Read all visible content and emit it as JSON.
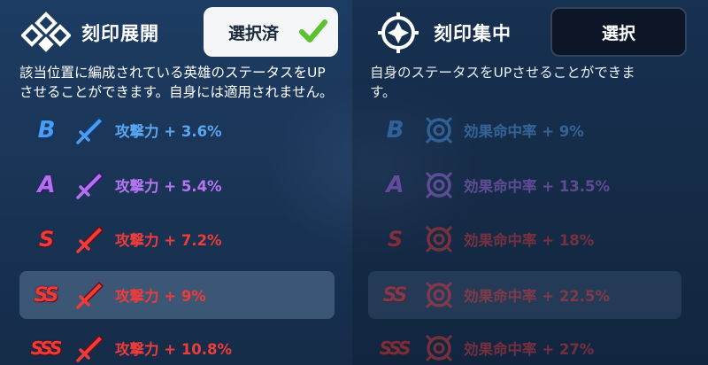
{
  "left_panel": {
    "title": "刻印展開",
    "button_label": "選択済",
    "button_state": "selected",
    "description_line1": "該当位置に編成されている英雄のステータスをUP",
    "description_line2": "させることができます。自身には適用されません。",
    "rows": [
      {
        "grade": "B",
        "stat_label": "攻撃力",
        "value": "+ 3.6%",
        "color": "#5aa6f2",
        "highlighted": false
      },
      {
        "grade": "A",
        "stat_label": "攻撃力",
        "value": "+ 5.4%",
        "color": "#b676f2",
        "highlighted": false
      },
      {
        "grade": "S",
        "stat_label": "攻撃力",
        "value": "+ 7.2%",
        "color": "#ee3b3b",
        "highlighted": false
      },
      {
        "grade": "SS",
        "stat_label": "攻撃力",
        "value": "+ 9%",
        "color": "#ee3b3b",
        "highlighted": true
      },
      {
        "grade": "SSS",
        "stat_label": "攻撃力",
        "value": "+ 10.8%",
        "color": "#ee3b3b",
        "highlighted": false
      }
    ]
  },
  "right_panel": {
    "title": "刻印集中",
    "button_label": "選択",
    "button_state": "unselected",
    "description_line1": "自身のステータスをUPさせることができま",
    "description_line2": "す。",
    "rows": [
      {
        "grade": "B",
        "stat_label": "効果命中率",
        "value": "+ 9%",
        "color": "#5aa6f2",
        "highlighted": false
      },
      {
        "grade": "A",
        "stat_label": "効果命中率",
        "value": "+ 13.5%",
        "color": "#b676f2",
        "highlighted": false
      },
      {
        "grade": "S",
        "stat_label": "効果命中率",
        "value": "+ 18%",
        "color": "#ee3b3b",
        "highlighted": false
      },
      {
        "grade": "SS",
        "stat_label": "効果命中率",
        "value": "+ 22.5%",
        "color": "#ee3b3b",
        "highlighted": true
      },
      {
        "grade": "SSS",
        "stat_label": "効果命中率",
        "value": "+ 27%",
        "color": "#ee3b3b",
        "highlighted": false
      }
    ]
  },
  "icons": {
    "left_emblem": "spread-diamonds-icon",
    "right_emblem": "crosshair-focus-icon",
    "attack_stat": "sword-icon",
    "effectiveness_stat": "target-icon",
    "selected_check": "check-icon"
  }
}
